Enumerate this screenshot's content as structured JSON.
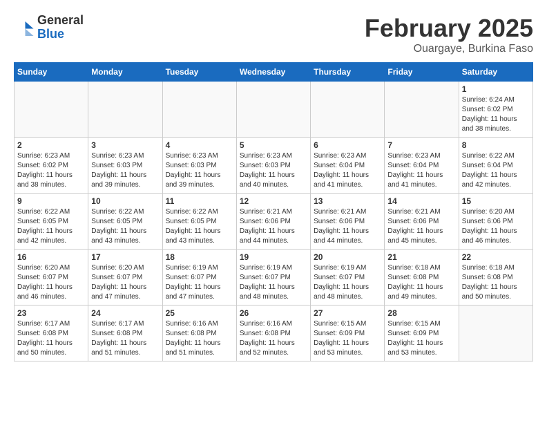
{
  "header": {
    "logo_general": "General",
    "logo_blue": "Blue",
    "month_year": "February 2025",
    "location": "Ouargaye, Burkina Faso"
  },
  "weekdays": [
    "Sunday",
    "Monday",
    "Tuesday",
    "Wednesday",
    "Thursday",
    "Friday",
    "Saturday"
  ],
  "weeks": [
    [
      {
        "day": "",
        "info": ""
      },
      {
        "day": "",
        "info": ""
      },
      {
        "day": "",
        "info": ""
      },
      {
        "day": "",
        "info": ""
      },
      {
        "day": "",
        "info": ""
      },
      {
        "day": "",
        "info": ""
      },
      {
        "day": "1",
        "info": "Sunrise: 6:24 AM\nSunset: 6:02 PM\nDaylight: 11 hours\nand 38 minutes."
      }
    ],
    [
      {
        "day": "2",
        "info": "Sunrise: 6:23 AM\nSunset: 6:02 PM\nDaylight: 11 hours\nand 38 minutes."
      },
      {
        "day": "3",
        "info": "Sunrise: 6:23 AM\nSunset: 6:03 PM\nDaylight: 11 hours\nand 39 minutes."
      },
      {
        "day": "4",
        "info": "Sunrise: 6:23 AM\nSunset: 6:03 PM\nDaylight: 11 hours\nand 39 minutes."
      },
      {
        "day": "5",
        "info": "Sunrise: 6:23 AM\nSunset: 6:03 PM\nDaylight: 11 hours\nand 40 minutes."
      },
      {
        "day": "6",
        "info": "Sunrise: 6:23 AM\nSunset: 6:04 PM\nDaylight: 11 hours\nand 41 minutes."
      },
      {
        "day": "7",
        "info": "Sunrise: 6:23 AM\nSunset: 6:04 PM\nDaylight: 11 hours\nand 41 minutes."
      },
      {
        "day": "8",
        "info": "Sunrise: 6:22 AM\nSunset: 6:04 PM\nDaylight: 11 hours\nand 42 minutes."
      }
    ],
    [
      {
        "day": "9",
        "info": "Sunrise: 6:22 AM\nSunset: 6:05 PM\nDaylight: 11 hours\nand 42 minutes."
      },
      {
        "day": "10",
        "info": "Sunrise: 6:22 AM\nSunset: 6:05 PM\nDaylight: 11 hours\nand 43 minutes."
      },
      {
        "day": "11",
        "info": "Sunrise: 6:22 AM\nSunset: 6:05 PM\nDaylight: 11 hours\nand 43 minutes."
      },
      {
        "day": "12",
        "info": "Sunrise: 6:21 AM\nSunset: 6:06 PM\nDaylight: 11 hours\nand 44 minutes."
      },
      {
        "day": "13",
        "info": "Sunrise: 6:21 AM\nSunset: 6:06 PM\nDaylight: 11 hours\nand 44 minutes."
      },
      {
        "day": "14",
        "info": "Sunrise: 6:21 AM\nSunset: 6:06 PM\nDaylight: 11 hours\nand 45 minutes."
      },
      {
        "day": "15",
        "info": "Sunrise: 6:20 AM\nSunset: 6:06 PM\nDaylight: 11 hours\nand 46 minutes."
      }
    ],
    [
      {
        "day": "16",
        "info": "Sunrise: 6:20 AM\nSunset: 6:07 PM\nDaylight: 11 hours\nand 46 minutes."
      },
      {
        "day": "17",
        "info": "Sunrise: 6:20 AM\nSunset: 6:07 PM\nDaylight: 11 hours\nand 47 minutes."
      },
      {
        "day": "18",
        "info": "Sunrise: 6:19 AM\nSunset: 6:07 PM\nDaylight: 11 hours\nand 47 minutes."
      },
      {
        "day": "19",
        "info": "Sunrise: 6:19 AM\nSunset: 6:07 PM\nDaylight: 11 hours\nand 48 minutes."
      },
      {
        "day": "20",
        "info": "Sunrise: 6:19 AM\nSunset: 6:07 PM\nDaylight: 11 hours\nand 48 minutes."
      },
      {
        "day": "21",
        "info": "Sunrise: 6:18 AM\nSunset: 6:08 PM\nDaylight: 11 hours\nand 49 minutes."
      },
      {
        "day": "22",
        "info": "Sunrise: 6:18 AM\nSunset: 6:08 PM\nDaylight: 11 hours\nand 50 minutes."
      }
    ],
    [
      {
        "day": "23",
        "info": "Sunrise: 6:17 AM\nSunset: 6:08 PM\nDaylight: 11 hours\nand 50 minutes."
      },
      {
        "day": "24",
        "info": "Sunrise: 6:17 AM\nSunset: 6:08 PM\nDaylight: 11 hours\nand 51 minutes."
      },
      {
        "day": "25",
        "info": "Sunrise: 6:16 AM\nSunset: 6:08 PM\nDaylight: 11 hours\nand 51 minutes."
      },
      {
        "day": "26",
        "info": "Sunrise: 6:16 AM\nSunset: 6:08 PM\nDaylight: 11 hours\nand 52 minutes."
      },
      {
        "day": "27",
        "info": "Sunrise: 6:15 AM\nSunset: 6:09 PM\nDaylight: 11 hours\nand 53 minutes."
      },
      {
        "day": "28",
        "info": "Sunrise: 6:15 AM\nSunset: 6:09 PM\nDaylight: 11 hours\nand 53 minutes."
      },
      {
        "day": "",
        "info": ""
      }
    ]
  ]
}
